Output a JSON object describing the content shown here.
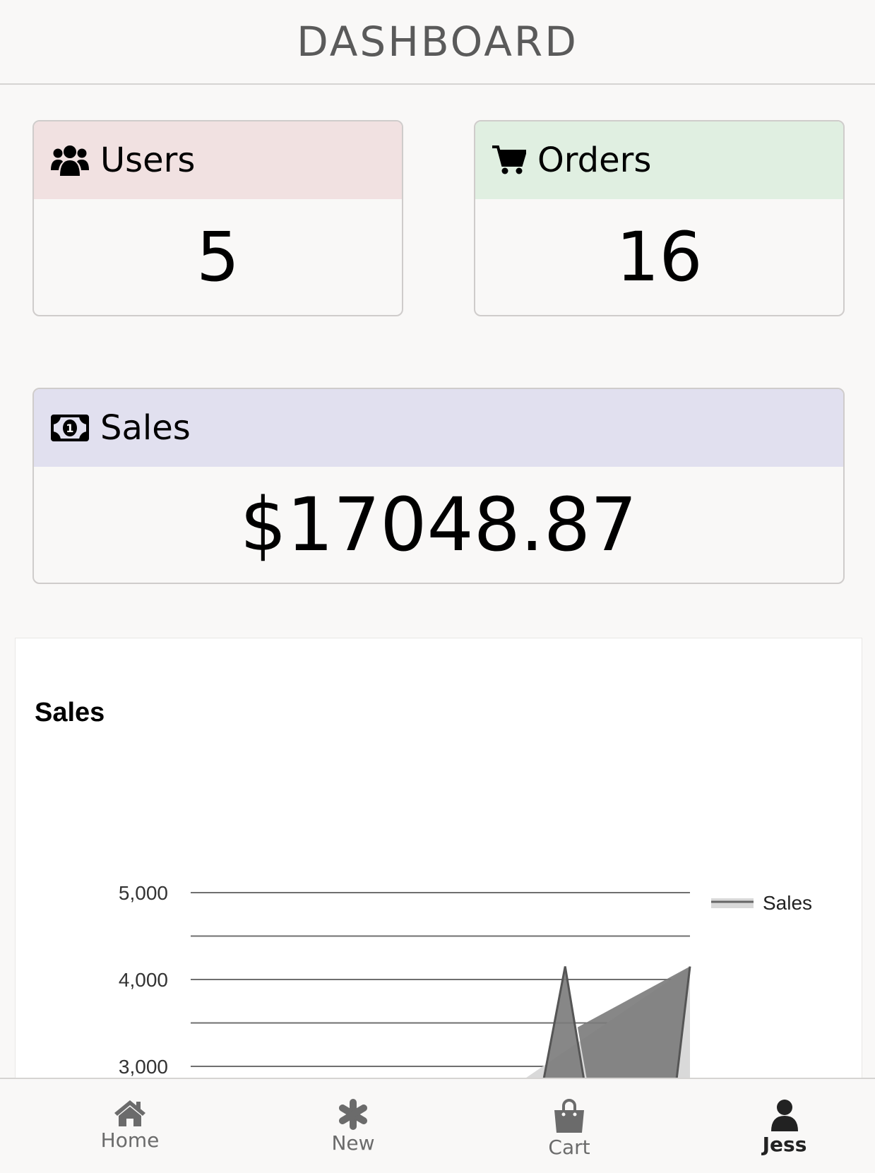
{
  "header": {
    "title": "DASHBOARD"
  },
  "cards": {
    "users": {
      "label": "Users",
      "value": "5",
      "icon": "users-icon",
      "color": "#f1e1e1"
    },
    "orders": {
      "label": "Orders",
      "value": "16",
      "icon": "cart-icon",
      "color": "#e0efe1"
    },
    "sales": {
      "label": "Sales",
      "value": "$17048.87",
      "icon": "money-bill-icon",
      "color": "#e1e0ef"
    }
  },
  "chart_data": {
    "type": "area",
    "title": "Sales",
    "ylim": [
      2800,
      5000
    ],
    "yticks": [
      3000,
      4000,
      5000
    ],
    "ytick_labels": [
      "3,000",
      "4,000",
      "5,000"
    ],
    "legend": {
      "position": "right",
      "entries": [
        "Sales"
      ]
    },
    "series": [
      {
        "name": "Sales",
        "values": [
          2800,
          2800,
          2800,
          2800,
          2800,
          2800,
          4150,
          2800,
          4150
        ]
      }
    ]
  },
  "nav": {
    "items": [
      {
        "label": "Home",
        "icon": "home-icon"
      },
      {
        "label": "New",
        "icon": "asterisk-icon"
      },
      {
        "label": "Cart",
        "icon": "shopping-bag-icon"
      },
      {
        "label": "Jess",
        "icon": "user-icon",
        "active": true
      }
    ]
  }
}
